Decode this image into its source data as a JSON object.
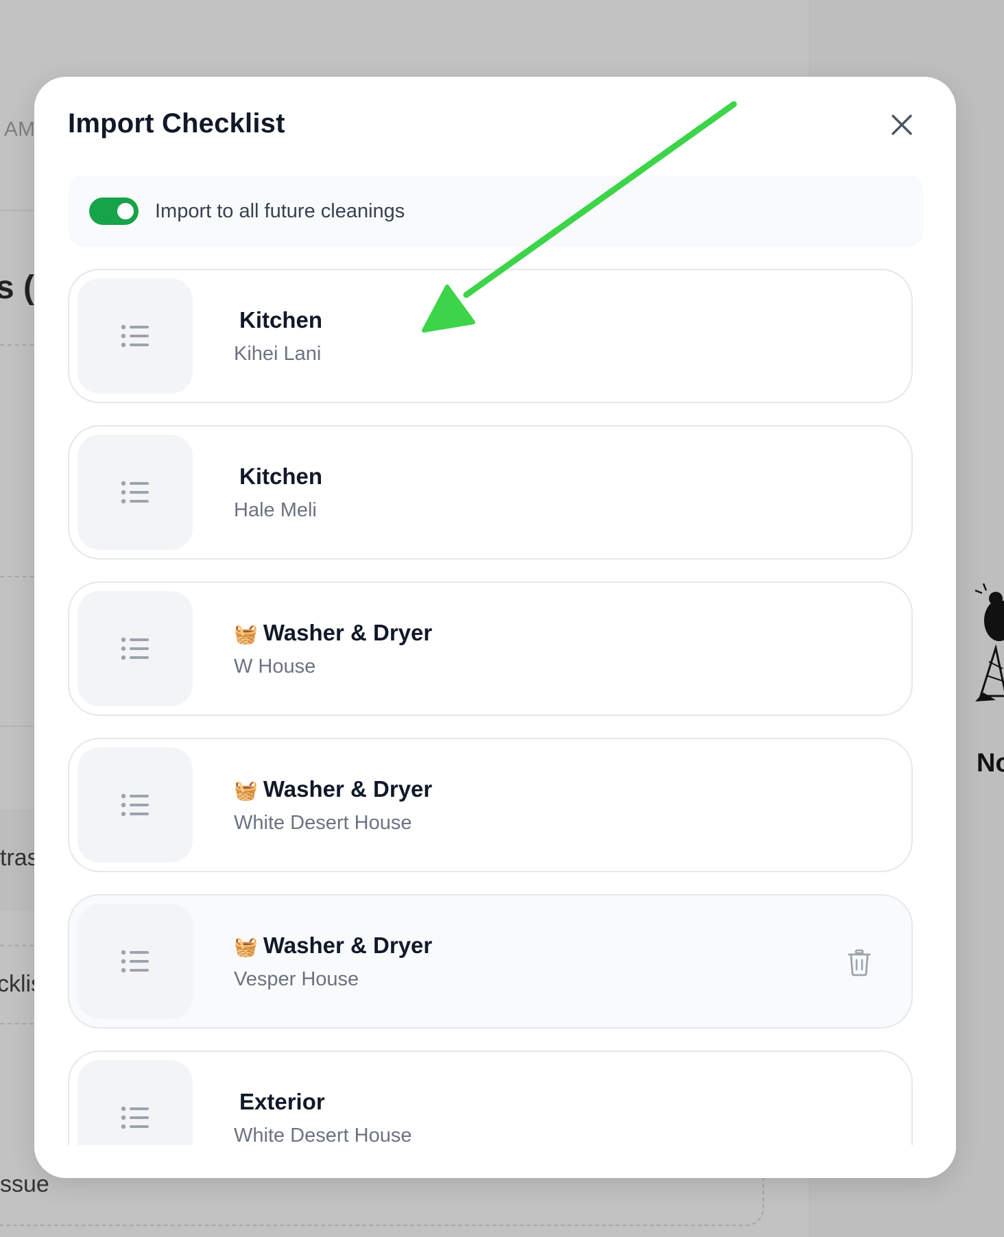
{
  "background": {
    "time_fragment": "AM",
    "heading_fragment": "s (",
    "extras_fragment": "tras",
    "checklist_fragment": "cklis",
    "issue_fragment": "ssue",
    "empty_state_fragment": "No"
  },
  "modal": {
    "title": "Import Checklist",
    "close_icon": "close-icon",
    "toggle": {
      "label": "Import to all future cleanings",
      "checked": true,
      "color": "#16a34a"
    },
    "items": [
      {
        "emoji": "",
        "title": "Kitchen",
        "subtitle": "Kihei Lani"
      },
      {
        "emoji": "",
        "title": "Kitchen",
        "subtitle": "Hale Meli"
      },
      {
        "emoji": "🧺",
        "title": "Washer & Dryer",
        "subtitle": "W House"
      },
      {
        "emoji": "🧺",
        "title": "Washer & Dryer",
        "subtitle": "White Desert House"
      },
      {
        "emoji": "🧺",
        "title": "Washer & Dryer",
        "subtitle": "Vesper House",
        "hovered": true,
        "delete_icon": "trash-icon"
      },
      {
        "emoji": "",
        "title": "Exterior",
        "subtitle": "White Desert House"
      }
    ]
  },
  "annotation": {
    "arrow_color": "#3dd44a",
    "arrow_icon": "arrow-annotation-icon"
  }
}
